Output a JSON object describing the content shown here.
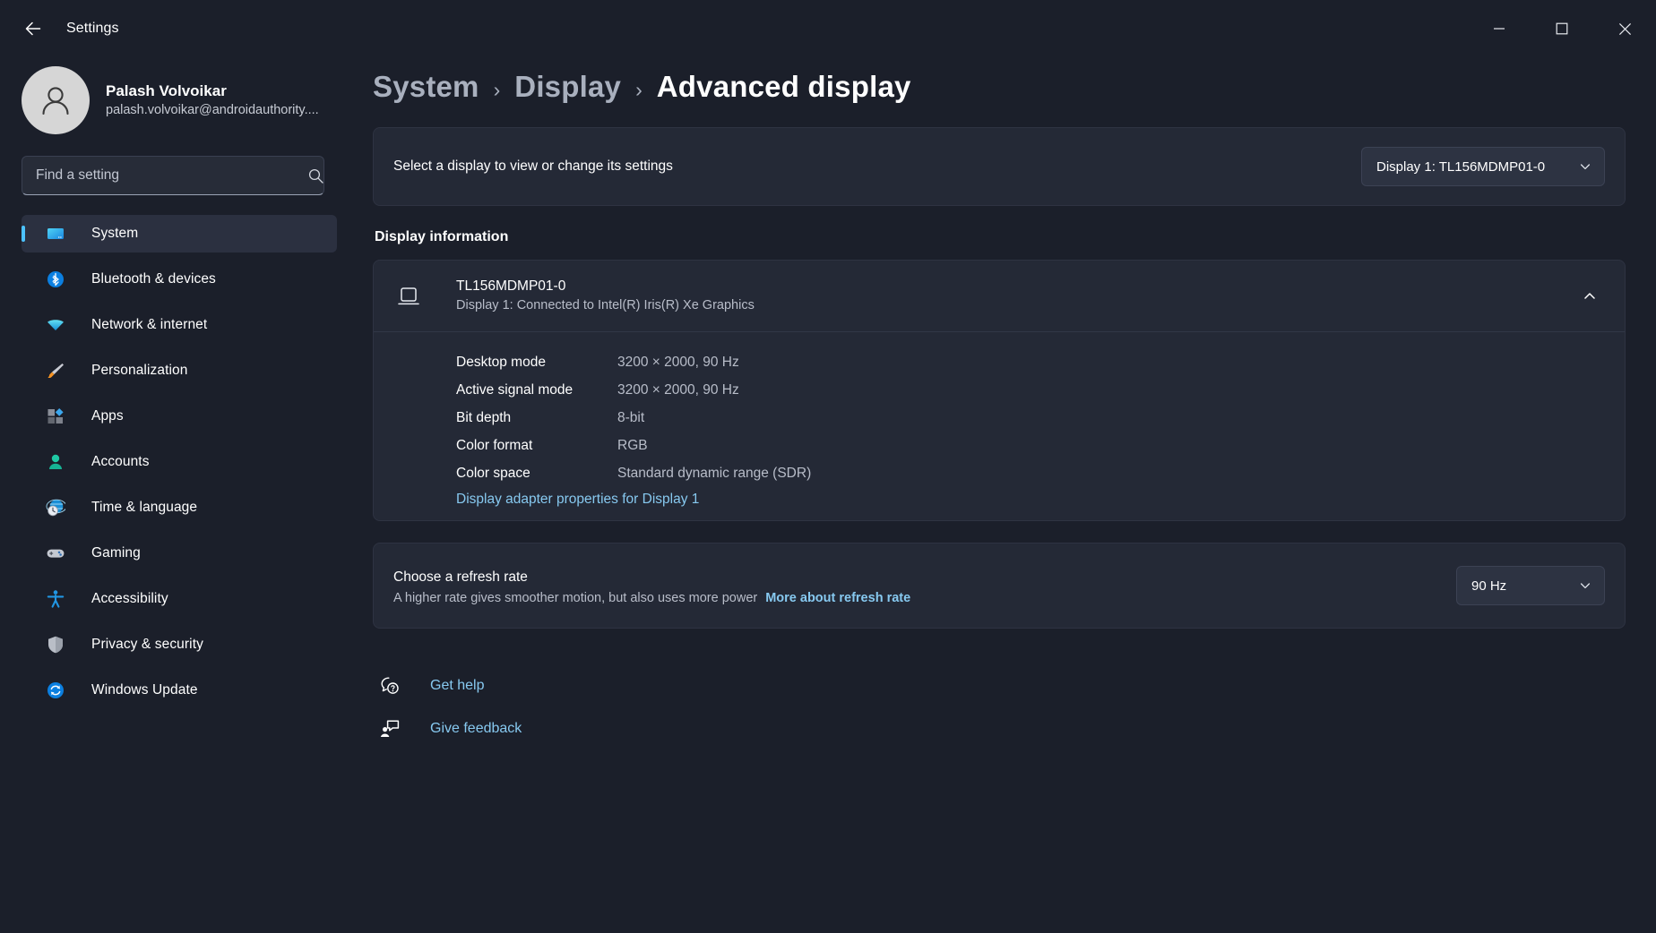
{
  "window": {
    "title": "Settings",
    "back_icon": "arrow-left-icon",
    "controls": {
      "minimize": "minimize-icon",
      "maximize": "maximize-icon",
      "close": "close-icon"
    }
  },
  "sidebar": {
    "profile": {
      "name": "Palash Volvoikar",
      "email": "palash.volvoikar@androidauthority....",
      "avatar_icon": "person-avatar-icon"
    },
    "search": {
      "placeholder": "Find a setting",
      "value": "",
      "icon": "search-icon"
    },
    "items": [
      {
        "label": "System",
        "icon": "monitor-icon",
        "selected": true
      },
      {
        "label": "Bluetooth & devices",
        "icon": "bluetooth-icon",
        "selected": false
      },
      {
        "label": "Network & internet",
        "icon": "wifi-icon",
        "selected": false
      },
      {
        "label": "Personalization",
        "icon": "paintbrush-icon",
        "selected": false
      },
      {
        "label": "Apps",
        "icon": "apps-grid-icon",
        "selected": false
      },
      {
        "label": "Accounts",
        "icon": "account-person-icon",
        "selected": false
      },
      {
        "label": "Time & language",
        "icon": "clock-globe-icon",
        "selected": false
      },
      {
        "label": "Gaming",
        "icon": "gamepad-icon",
        "selected": false
      },
      {
        "label": "Accessibility",
        "icon": "accessibility-person-icon",
        "selected": false
      },
      {
        "label": "Privacy & security",
        "icon": "shield-icon",
        "selected": false
      },
      {
        "label": "Windows Update",
        "icon": "update-refresh-icon",
        "selected": false
      }
    ]
  },
  "breadcrumb": {
    "items": [
      "System",
      "Display",
      "Advanced display"
    ],
    "separator": "›"
  },
  "select_display": {
    "label": "Select a display to view or change its settings",
    "dropdown_value": "Display 1: TL156MDMP01-0",
    "chevron_icon": "chevron-down-icon"
  },
  "display_information": {
    "section_title": "Display information",
    "monitor_icon": "laptop-display-icon",
    "device_name": "TL156MDMP01-0",
    "device_sub": "Display 1: Connected to Intel(R) Iris(R) Xe Graphics",
    "expand_icon": "chevron-up-icon",
    "rows": [
      {
        "key": "Desktop mode",
        "value": "3200 × 2000, 90 Hz"
      },
      {
        "key": "Active signal mode",
        "value": "3200 × 2000, 90 Hz"
      },
      {
        "key": "Bit depth",
        "value": "8-bit"
      },
      {
        "key": "Color format",
        "value": "RGB"
      },
      {
        "key": "Color space",
        "value": "Standard dynamic range (SDR)"
      }
    ],
    "adapter_link": "Display adapter properties for Display 1"
  },
  "refresh_rate": {
    "title": "Choose a refresh rate",
    "description": "A higher rate gives smoother motion, but also uses more power",
    "link": "More about refresh rate",
    "dropdown_value": "90 Hz",
    "chevron_icon": "chevron-down-icon"
  },
  "footer": {
    "get_help": {
      "label": "Get help",
      "icon": "help-question-icon"
    },
    "give_feedback": {
      "label": "Give feedback",
      "icon": "feedback-person-icon"
    }
  },
  "colors": {
    "accent": "#4cc2ff",
    "link": "#87c9f0",
    "window_bg": "#1b1f2a",
    "card_bg": "#242936",
    "close_hover": "#c42b1c"
  }
}
